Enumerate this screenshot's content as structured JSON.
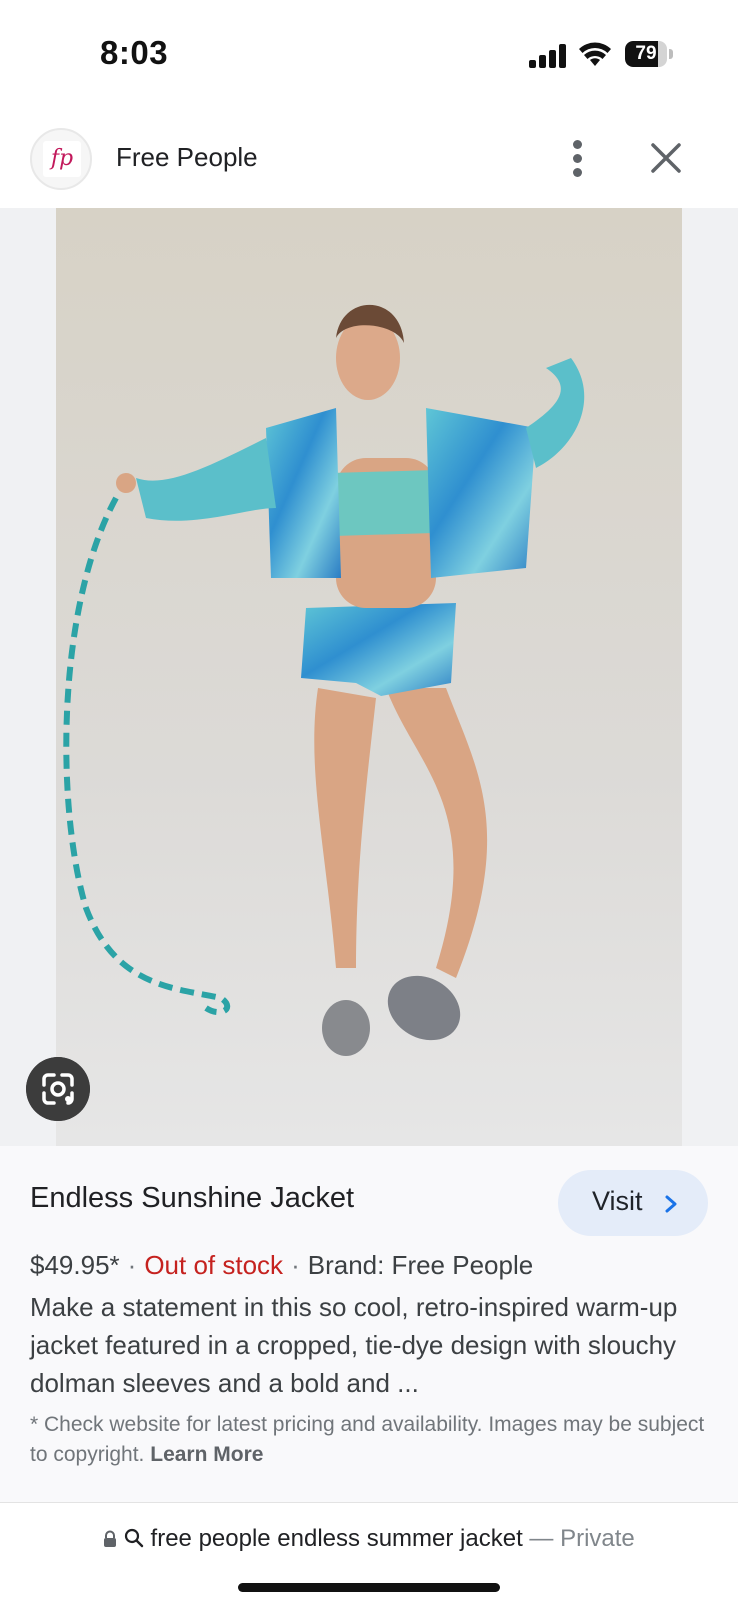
{
  "status_bar": {
    "time": "8:03",
    "battery_level": "79",
    "battery_fraction": 0.79
  },
  "header": {
    "site_name": "Free People",
    "logo_text": "fp"
  },
  "product": {
    "title": "Endless Sunshine Jacket",
    "visit_label": "Visit",
    "price": "$49.95*",
    "stock": "Out of stock",
    "brand": "Brand: Free People",
    "separator": "·",
    "description": "Make a statement in this so cool, retro-inspired warm-up jacket featured in a cropped, tie-dye design with slouchy dolman sleeves and a bold and ...",
    "disclaimer": "* Check website for latest pricing and availability. Images may be subject to copyright.",
    "learn_more": "Learn More"
  },
  "bottom_bar": {
    "query": "free people endless summer jacket",
    "suffix": "— Private"
  },
  "colors": {
    "out_of_stock": "#c5221f",
    "visit_button_bg": "#e4ecf9",
    "link_accent": "#1a73e8"
  },
  "icons": [
    "signal-icon",
    "wifi-icon",
    "battery-icon",
    "more-vert-icon",
    "close-icon",
    "google-lens-icon",
    "chevron-right-icon",
    "lock-icon",
    "search-icon"
  ]
}
